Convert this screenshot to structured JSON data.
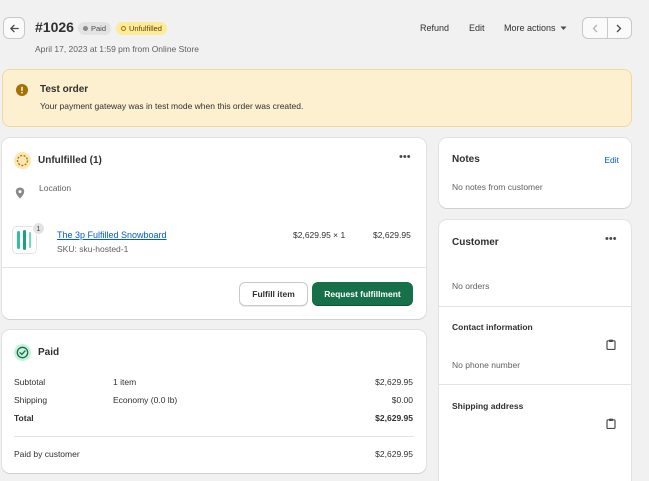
{
  "header": {
    "order_number": "#1026",
    "paid_badge": "Paid",
    "unfulfilled_badge": "Unfulfilled",
    "subtitle": "April 17, 2023 at 1:59 pm from Online Store",
    "refund_label": "Refund",
    "edit_label": "Edit",
    "more_actions_label": "More actions"
  },
  "banner": {
    "title": "Test order",
    "message": "Your payment gateway was in test mode when this order was created."
  },
  "fulfillment": {
    "title": "Unfulfilled (1)",
    "location_label": "Location",
    "item": {
      "quantity_badge": "1",
      "name": "The 3p Fulfilled Snowboard",
      "sku": "SKU: sku-hosted-1",
      "price_qty": "$2,629.95 × 1",
      "total": "$2,629.95"
    },
    "fulfill_item_label": "Fulfill item",
    "request_fulfillment_label": "Request fulfillment"
  },
  "payment": {
    "title": "Paid",
    "rows": [
      {
        "label": "Subtotal",
        "detail": "1 item",
        "amount": "$2,629.95"
      },
      {
        "label": "Shipping",
        "detail": "Economy (0.0 lb)",
        "amount": "$0.00"
      },
      {
        "label": "Total",
        "detail": "",
        "amount": "$2,629.95"
      }
    ],
    "paid_by_label": "Paid by customer",
    "paid_by_amount": "$2,629.95"
  },
  "notes": {
    "title": "Notes",
    "edit_label": "Edit",
    "empty_text": "No notes from customer"
  },
  "customer": {
    "title": "Customer",
    "orders_text": "No orders",
    "contact_title": "Contact information",
    "phone_text": "No phone number",
    "shipping_title": "Shipping address"
  },
  "colors": {
    "primary_button": "#16704a",
    "banner_bg": "#fdf0d0",
    "warning_icon": "#a37200",
    "unfulfilled_badge_bg": "#fdeb9a",
    "paid_badge_bg": "#e3e3e3",
    "link": "#005bd3"
  }
}
